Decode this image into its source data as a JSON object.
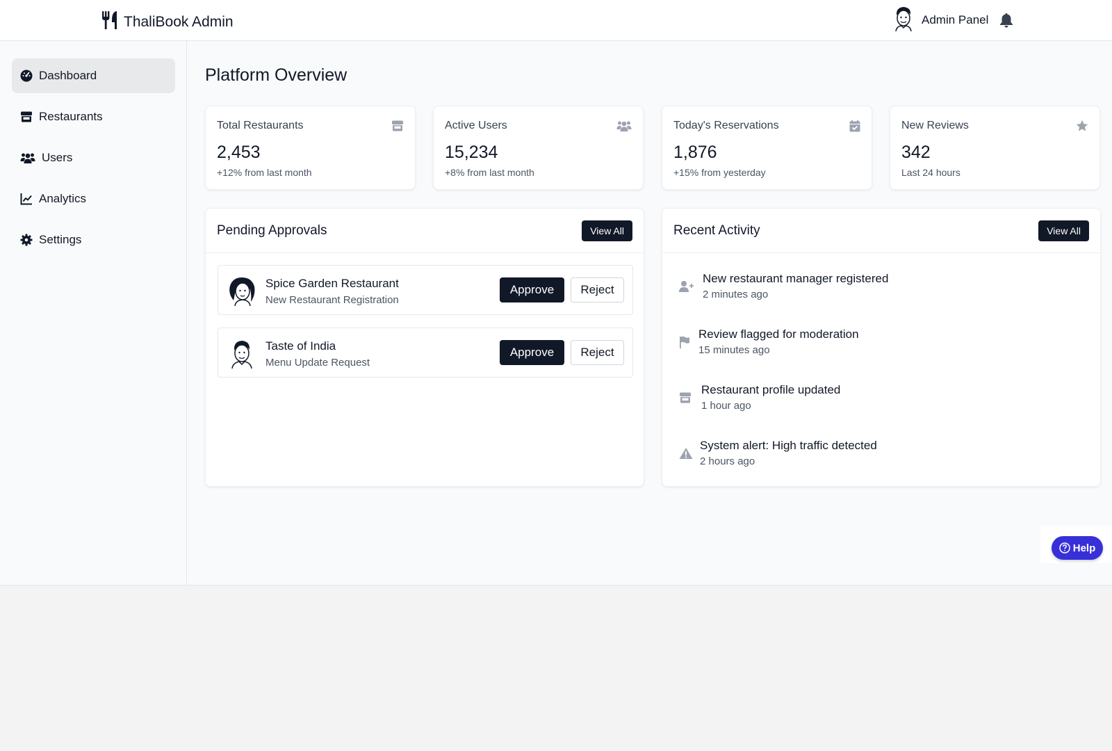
{
  "header": {
    "brand_icon": "utensils-icon",
    "brand": "ThaliBook Admin",
    "admin_label": "Admin Panel",
    "bell_icon": "bell-icon"
  },
  "sidebar": {
    "items": [
      {
        "label": "Dashboard",
        "icon": "gauge-icon",
        "active": true
      },
      {
        "label": "Restaurants",
        "icon": "store-icon",
        "active": false
      },
      {
        "label": "Users",
        "icon": "users-icon",
        "active": false
      },
      {
        "label": "Analytics",
        "icon": "chart-line-icon",
        "active": false
      },
      {
        "label": "Settings",
        "icon": "gear-icon",
        "active": false
      }
    ]
  },
  "main": {
    "title": "Platform Overview",
    "stats": [
      {
        "label": "Total Restaurants",
        "value": "2,453",
        "sub": "+12% from last month",
        "icon": "store-icon"
      },
      {
        "label": "Active Users",
        "value": "15,234",
        "sub": "+8% from last month",
        "icon": "users-icon"
      },
      {
        "label": "Today's Reservations",
        "value": "1,876",
        "sub": "+15% from yesterday",
        "icon": "calendar-check-icon"
      },
      {
        "label": "New Reviews",
        "value": "342",
        "sub": "Last 24 hours",
        "icon": "star-icon"
      }
    ],
    "pending": {
      "title": "Pending Approvals",
      "view_all": "View All",
      "items": [
        {
          "name": "Spice Garden Restaurant",
          "type": "New Restaurant Registration",
          "approve": "Approve",
          "reject": "Reject"
        },
        {
          "name": "Taste of India",
          "type": "Menu Update Request",
          "approve": "Approve",
          "reject": "Reject"
        }
      ]
    },
    "activity": {
      "title": "Recent Activity",
      "view_all": "View All",
      "items": [
        {
          "text": "New restaurant manager registered",
          "time": "2 minutes ago",
          "icon": "user-plus-icon"
        },
        {
          "text": "Review flagged for moderation",
          "time": "15 minutes ago",
          "icon": "flag-icon"
        },
        {
          "text": "Restaurant profile updated",
          "time": "1 hour ago",
          "icon": "store-icon"
        },
        {
          "text": "System alert: High traffic detected",
          "time": "2 hours ago",
          "icon": "warning-icon"
        }
      ]
    }
  },
  "help": {
    "label": "Help",
    "icon": "question-circle-icon"
  },
  "colors": {
    "primary": "#111827",
    "help": "#3730d8",
    "muted_icon": "#9ca3af"
  }
}
